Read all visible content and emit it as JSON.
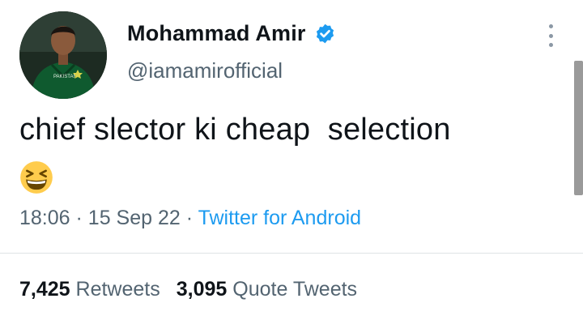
{
  "user": {
    "display_name": "Mohammad Amir",
    "handle": "@iamamirofficial",
    "verified": true,
    "avatar_jersey_text": "PAKISTAN"
  },
  "tweet": {
    "text": "chief slector ki cheap  selection",
    "emoji": "grinning-squinting-face"
  },
  "meta": {
    "time": "18:06",
    "date": "15 Sep 22",
    "separator": "·",
    "source": "Twitter for Android"
  },
  "stats": {
    "retweets_count": "7,425",
    "retweets_label": "Retweets",
    "quotes_count": "3,095",
    "quotes_label": "Quote Tweets"
  },
  "colors": {
    "text_primary": "#0f1419",
    "text_secondary": "#536471",
    "link": "#1d9bf0",
    "verified": "#1d9bf0"
  }
}
